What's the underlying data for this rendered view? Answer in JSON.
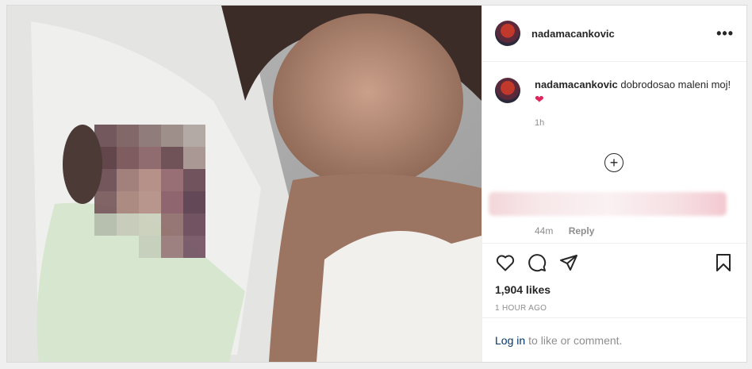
{
  "post": {
    "username": "nadamacankovic",
    "more_label": "•••",
    "caption": {
      "username": "nadamacankovic",
      "text": "dobrodosao maleni moj!",
      "emoji": "❤",
      "time": "1h"
    },
    "load_more_label": "+",
    "reply_comment": {
      "time": "44m",
      "reply_label": "Reply"
    },
    "likes": "1,904 likes",
    "posted_ago": "1 HOUR AGO",
    "login_link": "Log in",
    "login_suffix": "to like or comment."
  },
  "icons": {
    "like": "heart-icon",
    "comment": "comment-icon",
    "share": "share-icon",
    "save": "bookmark-icon",
    "more": "more-icon",
    "load_more": "plus-circle-icon"
  },
  "colors": {
    "link": "#00376b",
    "muted": "#8e8e8e",
    "text": "#262626",
    "heart": "#e0245e"
  }
}
